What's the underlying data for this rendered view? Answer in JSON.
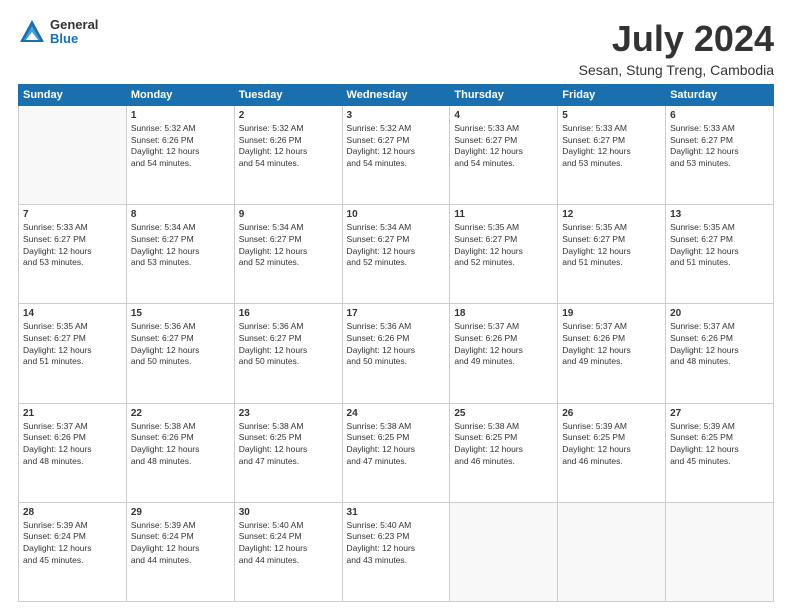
{
  "logo": {
    "general": "General",
    "blue": "Blue"
  },
  "title": "July 2024",
  "subtitle": "Sesan, Stung Treng, Cambodia",
  "days_of_week": [
    "Sunday",
    "Monday",
    "Tuesday",
    "Wednesday",
    "Thursday",
    "Friday",
    "Saturday"
  ],
  "weeks": [
    [
      {
        "day": "",
        "info": ""
      },
      {
        "day": "1",
        "info": "Sunrise: 5:32 AM\nSunset: 6:26 PM\nDaylight: 12 hours\nand 54 minutes."
      },
      {
        "day": "2",
        "info": "Sunrise: 5:32 AM\nSunset: 6:26 PM\nDaylight: 12 hours\nand 54 minutes."
      },
      {
        "day": "3",
        "info": "Sunrise: 5:32 AM\nSunset: 6:27 PM\nDaylight: 12 hours\nand 54 minutes."
      },
      {
        "day": "4",
        "info": "Sunrise: 5:33 AM\nSunset: 6:27 PM\nDaylight: 12 hours\nand 54 minutes."
      },
      {
        "day": "5",
        "info": "Sunrise: 5:33 AM\nSunset: 6:27 PM\nDaylight: 12 hours\nand 53 minutes."
      },
      {
        "day": "6",
        "info": "Sunrise: 5:33 AM\nSunset: 6:27 PM\nDaylight: 12 hours\nand 53 minutes."
      }
    ],
    [
      {
        "day": "7",
        "info": "Sunrise: 5:33 AM\nSunset: 6:27 PM\nDaylight: 12 hours\nand 53 minutes."
      },
      {
        "day": "8",
        "info": "Sunrise: 5:34 AM\nSunset: 6:27 PM\nDaylight: 12 hours\nand 53 minutes."
      },
      {
        "day": "9",
        "info": "Sunrise: 5:34 AM\nSunset: 6:27 PM\nDaylight: 12 hours\nand 52 minutes."
      },
      {
        "day": "10",
        "info": "Sunrise: 5:34 AM\nSunset: 6:27 PM\nDaylight: 12 hours\nand 52 minutes."
      },
      {
        "day": "11",
        "info": "Sunrise: 5:35 AM\nSunset: 6:27 PM\nDaylight: 12 hours\nand 52 minutes."
      },
      {
        "day": "12",
        "info": "Sunrise: 5:35 AM\nSunset: 6:27 PM\nDaylight: 12 hours\nand 51 minutes."
      },
      {
        "day": "13",
        "info": "Sunrise: 5:35 AM\nSunset: 6:27 PM\nDaylight: 12 hours\nand 51 minutes."
      }
    ],
    [
      {
        "day": "14",
        "info": "Sunrise: 5:35 AM\nSunset: 6:27 PM\nDaylight: 12 hours\nand 51 minutes."
      },
      {
        "day": "15",
        "info": "Sunrise: 5:36 AM\nSunset: 6:27 PM\nDaylight: 12 hours\nand 50 minutes."
      },
      {
        "day": "16",
        "info": "Sunrise: 5:36 AM\nSunset: 6:27 PM\nDaylight: 12 hours\nand 50 minutes."
      },
      {
        "day": "17",
        "info": "Sunrise: 5:36 AM\nSunset: 6:26 PM\nDaylight: 12 hours\nand 50 minutes."
      },
      {
        "day": "18",
        "info": "Sunrise: 5:37 AM\nSunset: 6:26 PM\nDaylight: 12 hours\nand 49 minutes."
      },
      {
        "day": "19",
        "info": "Sunrise: 5:37 AM\nSunset: 6:26 PM\nDaylight: 12 hours\nand 49 minutes."
      },
      {
        "day": "20",
        "info": "Sunrise: 5:37 AM\nSunset: 6:26 PM\nDaylight: 12 hours\nand 48 minutes."
      }
    ],
    [
      {
        "day": "21",
        "info": "Sunrise: 5:37 AM\nSunset: 6:26 PM\nDaylight: 12 hours\nand 48 minutes."
      },
      {
        "day": "22",
        "info": "Sunrise: 5:38 AM\nSunset: 6:26 PM\nDaylight: 12 hours\nand 48 minutes."
      },
      {
        "day": "23",
        "info": "Sunrise: 5:38 AM\nSunset: 6:25 PM\nDaylight: 12 hours\nand 47 minutes."
      },
      {
        "day": "24",
        "info": "Sunrise: 5:38 AM\nSunset: 6:25 PM\nDaylight: 12 hours\nand 47 minutes."
      },
      {
        "day": "25",
        "info": "Sunrise: 5:38 AM\nSunset: 6:25 PM\nDaylight: 12 hours\nand 46 minutes."
      },
      {
        "day": "26",
        "info": "Sunrise: 5:39 AM\nSunset: 6:25 PM\nDaylight: 12 hours\nand 46 minutes."
      },
      {
        "day": "27",
        "info": "Sunrise: 5:39 AM\nSunset: 6:25 PM\nDaylight: 12 hours\nand 45 minutes."
      }
    ],
    [
      {
        "day": "28",
        "info": "Sunrise: 5:39 AM\nSunset: 6:24 PM\nDaylight: 12 hours\nand 45 minutes."
      },
      {
        "day": "29",
        "info": "Sunrise: 5:39 AM\nSunset: 6:24 PM\nDaylight: 12 hours\nand 44 minutes."
      },
      {
        "day": "30",
        "info": "Sunrise: 5:40 AM\nSunset: 6:24 PM\nDaylight: 12 hours\nand 44 minutes."
      },
      {
        "day": "31",
        "info": "Sunrise: 5:40 AM\nSunset: 6:23 PM\nDaylight: 12 hours\nand 43 minutes."
      },
      {
        "day": "",
        "info": ""
      },
      {
        "day": "",
        "info": ""
      },
      {
        "day": "",
        "info": ""
      }
    ]
  ]
}
